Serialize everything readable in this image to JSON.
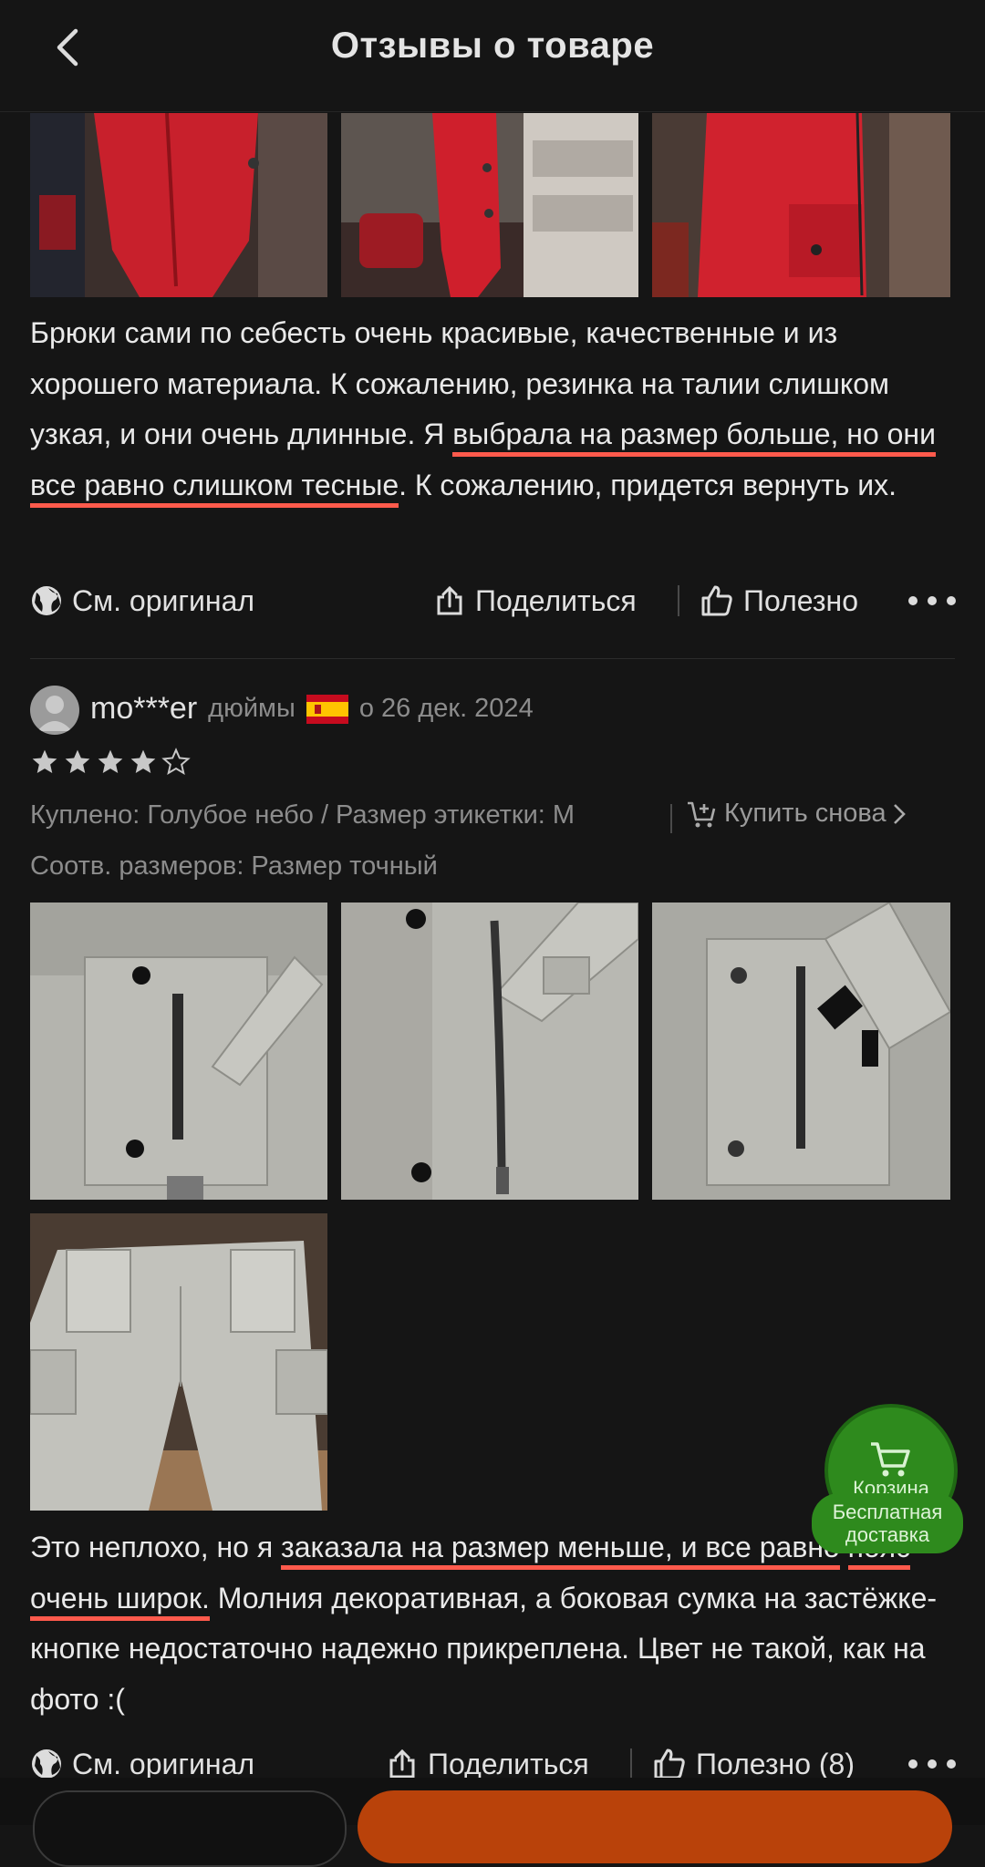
{
  "header": {
    "title": "Отзывы о товаре"
  },
  "review1": {
    "text_before": "Брюки сами по себесть очень красивые, качественные и из хорошего материала. К сожалению, резинка на талии слишком узкая, и они очень длинные. Я ",
    "text_highlight": "выбрала на размер больше, но они все равно слишком тесные",
    "text_after": ". К сожалению, придется вернуть их.",
    "see_original": "См. оригинал",
    "share": "Поделиться",
    "helpful": "Полезно"
  },
  "review2": {
    "username": "mo***er",
    "units": "дюймы",
    "date": "о 26 дек. 2024",
    "rating": 4,
    "rating_max": 5,
    "purchased": "Куплено: Голубое небо / Размер этикетки: M",
    "buy_again": "Купить снова",
    "size_fit": "Соотв. размеров: Размер точный",
    "text_before": "Это неплохо, но я ",
    "text_highlight_1": "заказала на размер меньше, и все равно",
    "text_highlight_2": "пояс очень широк.",
    "text_after": " Молния декоративная, а боковая сумка на застёжке-кнопке недостаточно надежно прикреплена. Цвет не такой, как на фото :(",
    "see_original": "См. оригинал",
    "share": "Поделиться",
    "helpful": "Полезно (8)"
  },
  "cart": {
    "label": "Корзина",
    "free_delivery": "Бесплатная доставка"
  },
  "colors": {
    "highlight": "#ff5a4c",
    "cart_green": "#2e8a1d",
    "bottom_button": "#b9420a"
  }
}
